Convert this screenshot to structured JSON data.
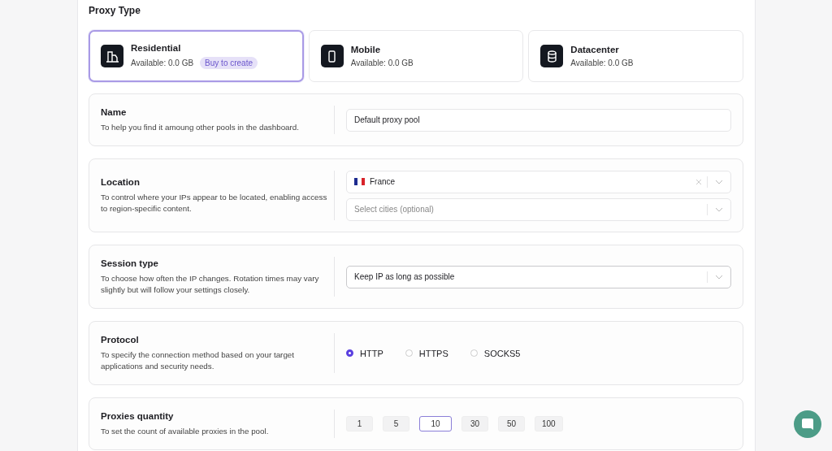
{
  "proxy_type": {
    "title": "Proxy Type",
    "options": [
      {
        "kind": "residential",
        "name": "Residential",
        "available": "Available: 0.0 GB",
        "badge": "Buy to create",
        "selected": true
      },
      {
        "kind": "mobile",
        "name": "Mobile",
        "available": "Available: 0.0 GB",
        "selected": false
      },
      {
        "kind": "datacenter",
        "name": "Datacenter",
        "available": "Available: 0.0 GB",
        "selected": false
      }
    ]
  },
  "sections": [
    {
      "kind": "text",
      "title": "Name",
      "description": "To help you find it amoung other pools in the dashboard.",
      "value": "Default proxy pool"
    },
    {
      "kind": "location",
      "title": "Location",
      "description": "To control where your IPs appear to be located, enabling access to region-specific content.",
      "country": "France",
      "cities_placeholder": "Select cities (optional)"
    },
    {
      "kind": "select",
      "title": "Session type",
      "description": "To choose how often the IP changes. Rotation times may vary slightly but will follow your settings closely.",
      "value": "Keep IP as long as possible"
    },
    {
      "kind": "radio",
      "title": "Protocol",
      "description": "To specify the connection method based on your target applications and security needs.",
      "options": [
        {
          "label": "HTTP",
          "selected": true
        },
        {
          "label": "HTTPS",
          "selected": false
        },
        {
          "label": "SOCKS5",
          "selected": false
        }
      ]
    },
    {
      "kind": "quantity",
      "title": "Proxies quantity",
      "description": "To set the count of available proxies in the pool.",
      "options": [
        {
          "label": "1",
          "selected": false
        },
        {
          "label": "5",
          "selected": false
        },
        {
          "label": "10",
          "selected": true
        },
        {
          "label": "30",
          "selected": false
        },
        {
          "label": "50",
          "selected": false
        },
        {
          "label": "100",
          "selected": false
        }
      ]
    }
  ]
}
